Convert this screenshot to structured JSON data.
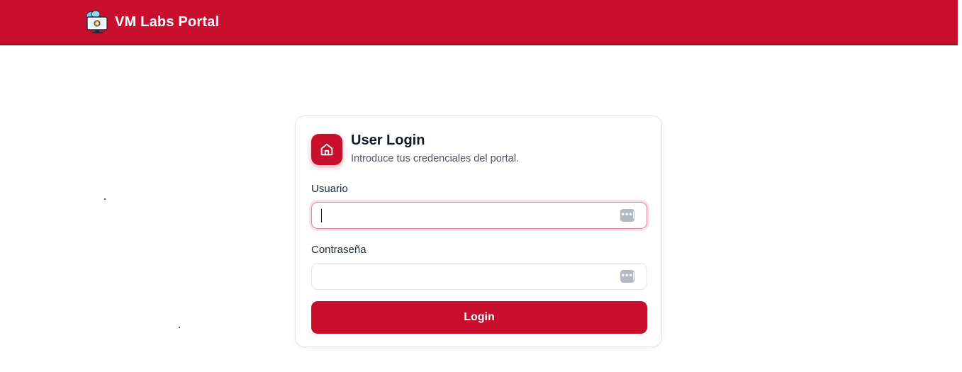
{
  "header": {
    "brand_title": "VM Labs Portal",
    "brand_icon": "cloud-monitor-gear-icon",
    "background_color": "#c8102e"
  },
  "login_card": {
    "icon": "home-icon",
    "title": "User Login",
    "subtitle": "Introduce tus credenciales del portal.",
    "username": {
      "label": "Usuario",
      "value": "",
      "autofill_icon": "password-manager-icon"
    },
    "password": {
      "label": "Contraseña",
      "value": "",
      "autofill_icon": "password-manager-icon"
    },
    "submit_label": "Login",
    "accent_color": "#c8102e"
  }
}
